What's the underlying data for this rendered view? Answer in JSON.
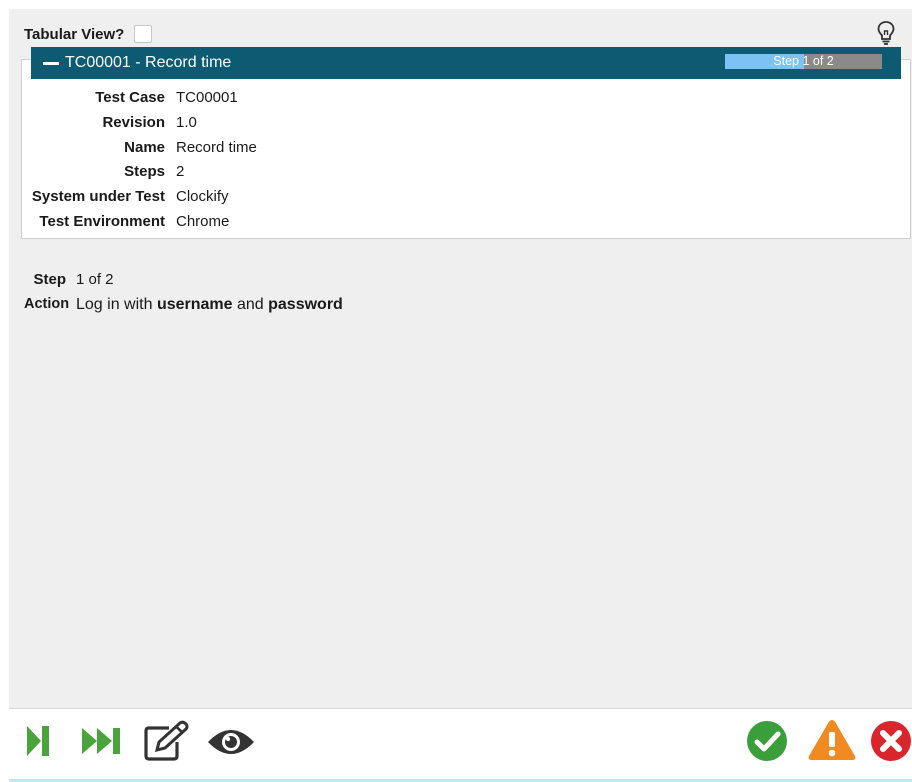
{
  "header": {
    "tabular_view_label": "Tabular View?"
  },
  "test_case": {
    "title": "TC00001 - Record time",
    "progress_text": "Step 1 of 2",
    "progress_fraction": 0.5,
    "fields": [
      {
        "label": "Test Case",
        "value": "TC00001"
      },
      {
        "label": "Revision",
        "value": "1.0"
      },
      {
        "label": "Name",
        "value": "Record time"
      },
      {
        "label": "Steps",
        "value": "2"
      },
      {
        "label": "System under Test",
        "value": "Clockify"
      },
      {
        "label": "Test Environment",
        "value": "Chrome"
      }
    ]
  },
  "step": {
    "step_label": "Step",
    "step_value": "1 of 2",
    "action_label": "Action",
    "action_parts": [
      {
        "text": "Log in with ",
        "bold": false
      },
      {
        "text": "username",
        "bold": true
      },
      {
        "text": " and ",
        "bold": false
      },
      {
        "text": "password",
        "bold": true
      }
    ]
  },
  "toolbar": {
    "icons": [
      "step-forward-icon",
      "fast-forward-icon",
      "edit-icon",
      "eye-icon",
      "pass-icon",
      "warning-icon",
      "fail-icon"
    ],
    "colors": {
      "green": "#4aa33b",
      "pass_green": "#3a9e3a",
      "warning_orange": "#f08a21",
      "fail_red": "#d8262c",
      "dark": "#333333"
    }
  },
  "colors": {
    "header_bg": "#0d5a73",
    "progress_fill": "#7cc3f3",
    "progress_bg": "#8a8a8a"
  }
}
